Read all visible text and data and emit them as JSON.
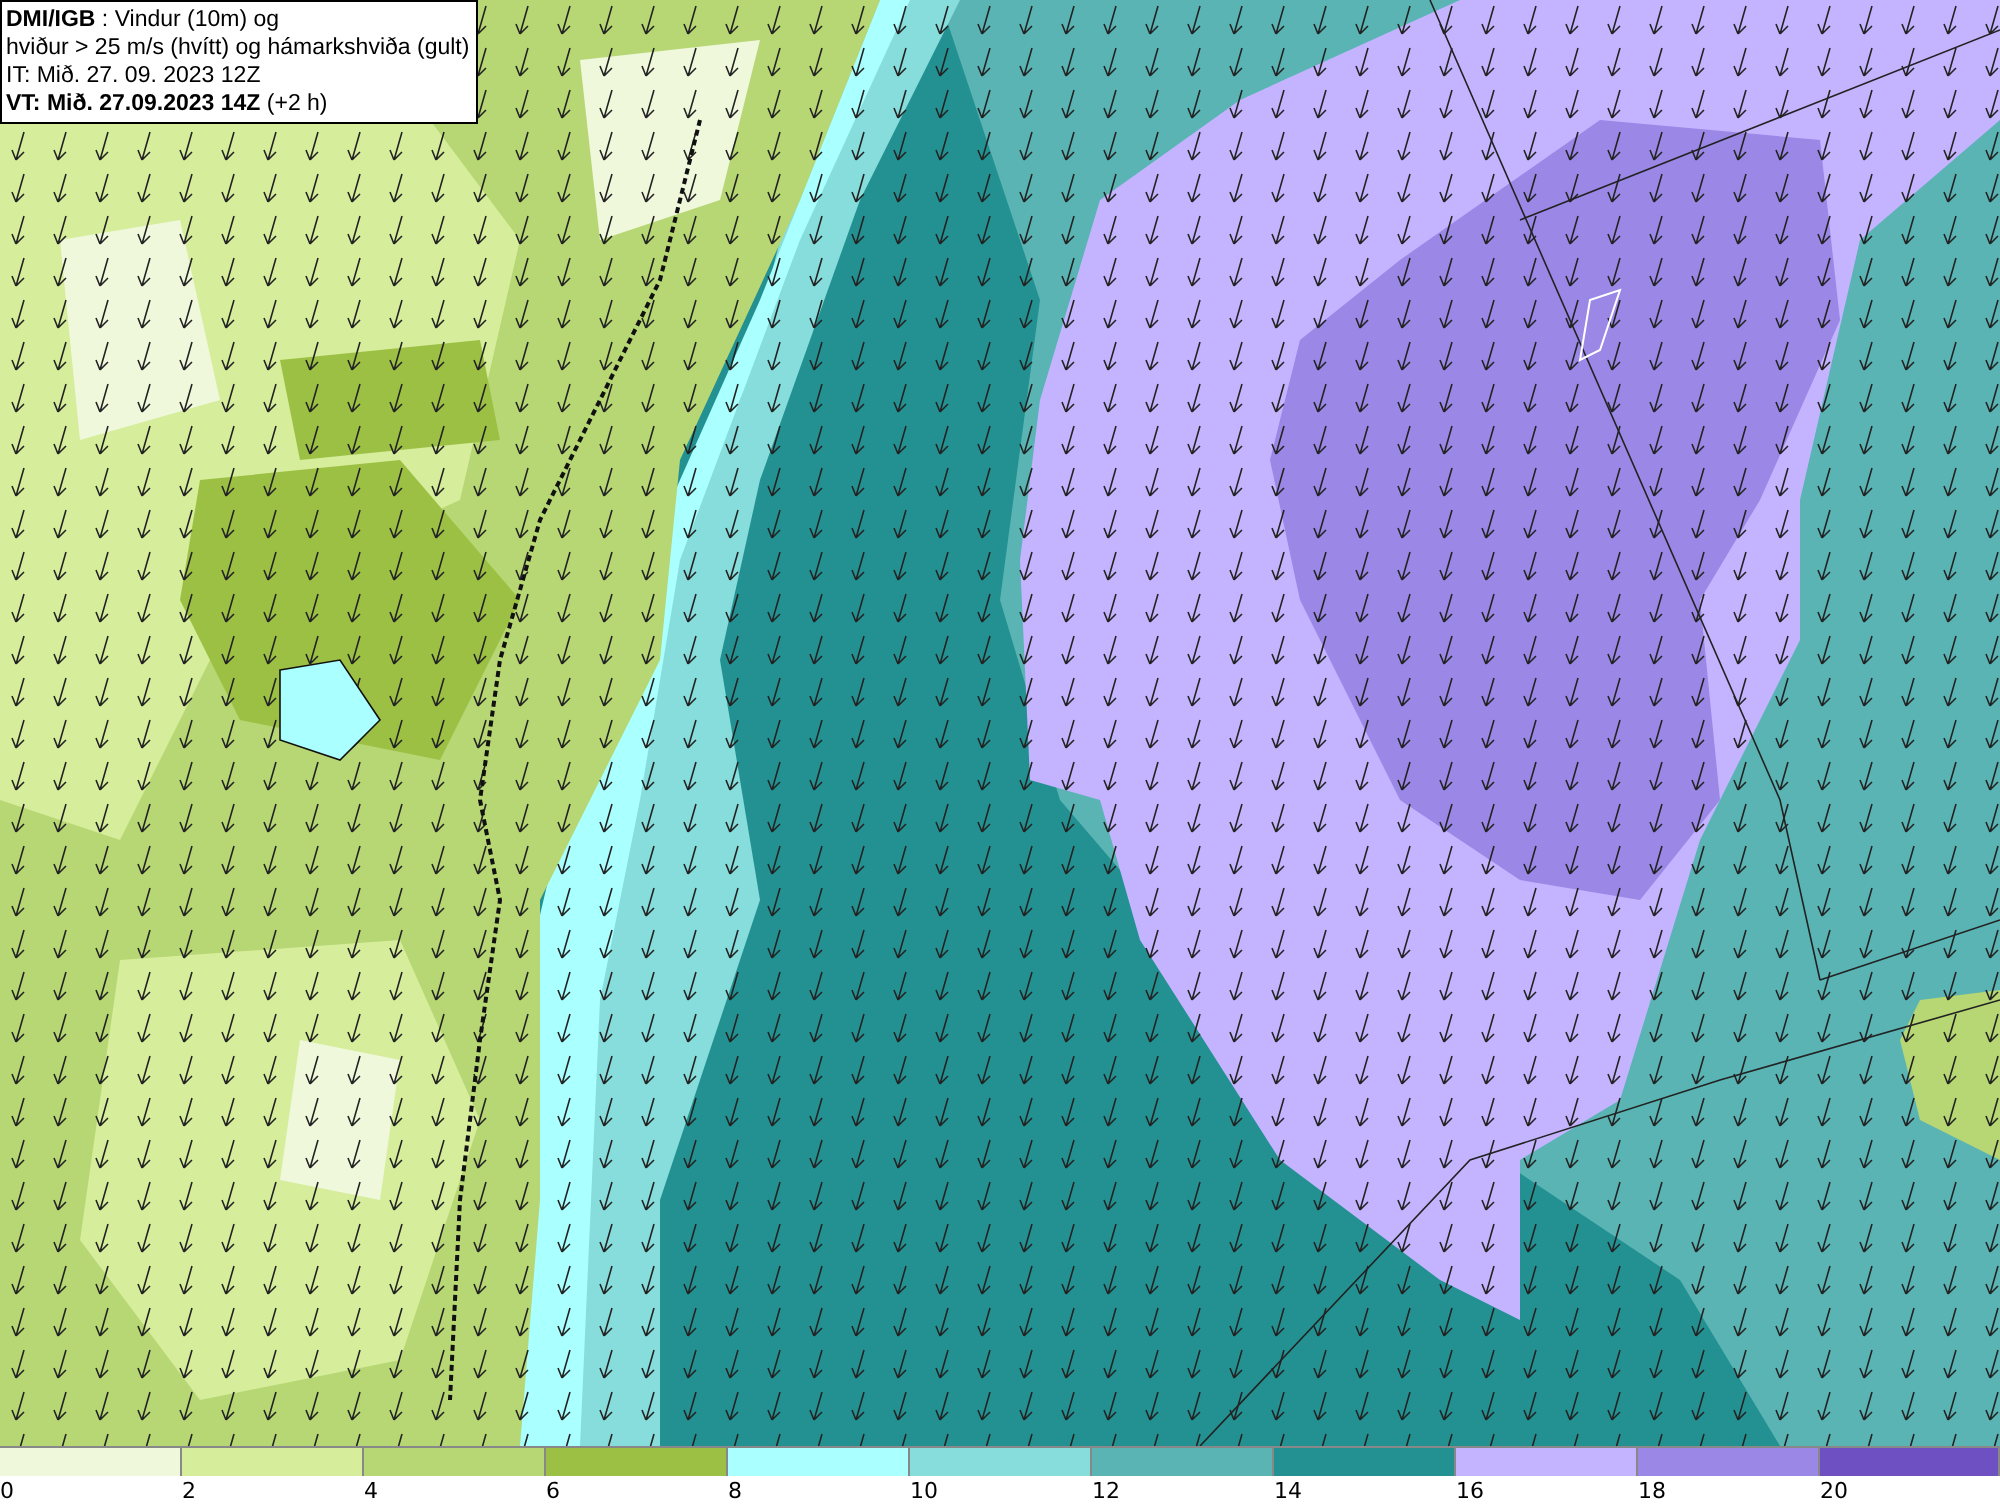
{
  "title_box": {
    "lines": [
      "**DMI/IGB** : Vindur (10m) og",
      "hviður > 25 m/s (hvítt) og hámarkshviða (gult)",
      "IT: Mið. 27. 09. 2023 12Z",
      "**VT: Mið. 27.09.2023 14Z** (+2 h)"
    ]
  },
  "legend": {
    "bins": [
      {
        "color": "#f0f8dc"
      },
      {
        "color": "#d6ed9c"
      },
      {
        "color": "#b6d773"
      },
      {
        "color": "#9cc044"
      },
      {
        "color": "#aaffff"
      },
      {
        "color": "#87dcdc"
      },
      {
        "color": "#5ab4b4"
      },
      {
        "color": "#239191"
      },
      {
        "color": "#c4b4ff"
      },
      {
        "color": "#9a87e6"
      },
      {
        "color": "#6e50c3"
      }
    ],
    "ticks": [
      "0",
      "2",
      "4",
      "6",
      "8",
      "10",
      "12",
      "14",
      "16",
      "18",
      "20"
    ]
  }
}
